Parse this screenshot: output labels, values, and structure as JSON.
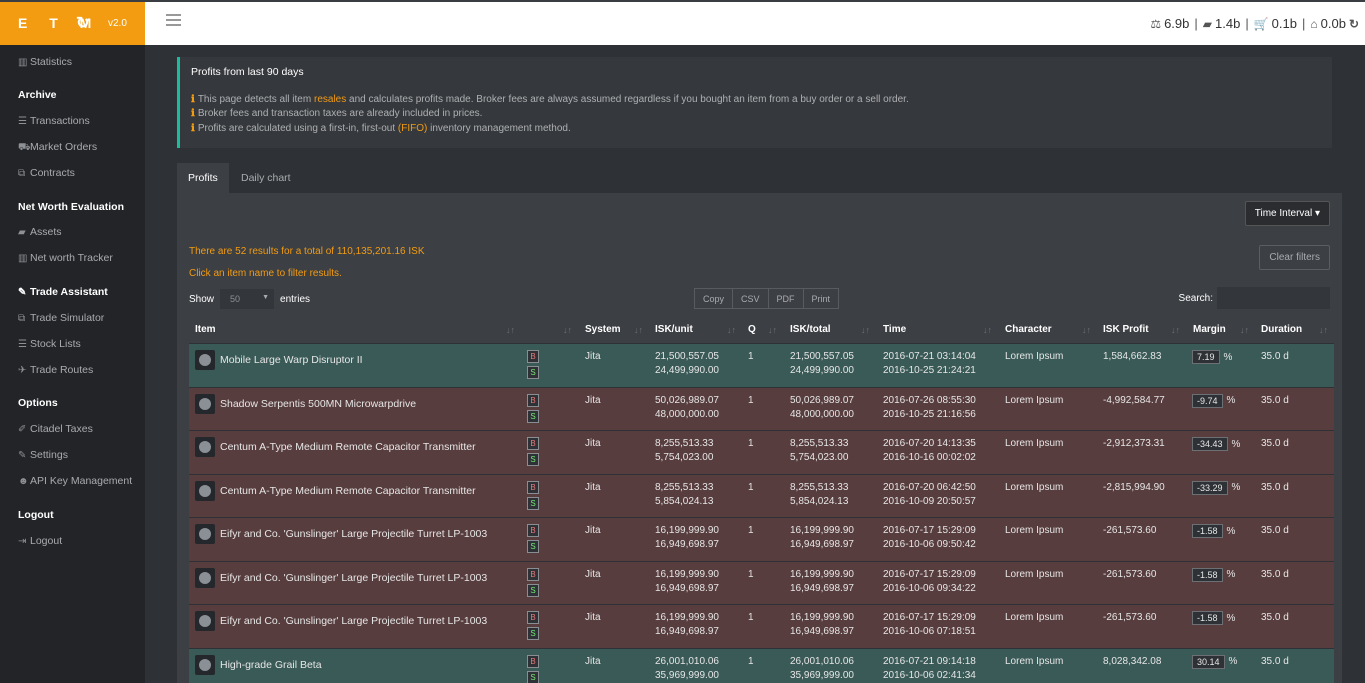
{
  "brand": {
    "logo": "E T M",
    "version": "v2.0"
  },
  "wallet": [
    {
      "icon": "balance-scale-icon",
      "value": "6.9b"
    },
    {
      "icon": "briefcase-icon",
      "value": "1.4b"
    },
    {
      "icon": "cart-icon",
      "value": "0.1b"
    },
    {
      "icon": "bank-icon",
      "value": "0.0b"
    }
  ],
  "sidebar": {
    "statistics": "Statistics",
    "archive_head": "Archive",
    "transactions": "Transactions",
    "market_orders": "Market Orders",
    "contracts": "Contracts",
    "networth_head": "Net Worth Evaluation",
    "assets": "Assets",
    "networth_tracker": "Net worth Tracker",
    "trade_assistant": "Trade Assistant",
    "trade_simulator": "Trade Simulator",
    "stock_lists": "Stock Lists",
    "trade_routes": "Trade Routes",
    "options_head": "Options",
    "citadel_taxes": "Citadel Taxes",
    "settings": "Settings",
    "api_key": "API Key Management",
    "logout_head": "Logout",
    "logout": "Logout"
  },
  "callout": {
    "title": "Profits from last 90 days",
    "line1_pre": "This page detects all item ",
    "line1_hl": "resales",
    "line1_post": " and calculates profits made. Broker fees are always assumed regardless if you bought an item from a buy order or a sell order.",
    "line2": "Broker fees and transaction taxes are already included in prices.",
    "line3_pre": "Profits are calculated using a first-in, first-out ",
    "line3_hl": "(FIFO)",
    "line3_post": " inventory management method."
  },
  "tabs": {
    "profits": "Profits",
    "daily_chart": "Daily chart"
  },
  "panel": {
    "time_interval": "Time Interval",
    "results": "There are 52 results for a total of 110,135,201.16 ISK",
    "hint": "Click an item name to filter results.",
    "clear_filters": "Clear filters",
    "show": "Show",
    "entries_value": "50",
    "entries": "entries",
    "search": "Search:",
    "exports": {
      "copy": "Copy",
      "csv": "CSV",
      "pdf": "PDF",
      "print": "Print"
    }
  },
  "columns": {
    "item": "Item",
    "system": "System",
    "isk_unit": "ISK/unit",
    "q": "Q",
    "isk_total": "ISK/total",
    "time": "Time",
    "character": "Character",
    "isk_profit": "ISK Profit",
    "margin": "Margin",
    "duration": "Duration"
  },
  "rows": [
    {
      "status": "pos",
      "item": "Mobile Large Warp Disruptor II",
      "system": "Jita",
      "unit1": "21,500,557.05",
      "unit2": "24,499,990.00",
      "q": "1",
      "total1": "21,500,557.05",
      "total2": "24,499,990.00",
      "time1": "2016-07-21 03:14:04",
      "time2": "2016-10-25 21:24:21",
      "character": "Lorem Ipsum",
      "profit": "1,584,662.83",
      "margin": "7.19",
      "duration": "35.0 d"
    },
    {
      "status": "neg",
      "item": "Shadow Serpentis 500MN Microwarpdrive",
      "system": "Jita",
      "unit1": "50,026,989.07",
      "unit2": "48,000,000.00",
      "q": "1",
      "total1": "50,026,989.07",
      "total2": "48,000,000.00",
      "time1": "2016-07-26 08:55:30",
      "time2": "2016-10-25 21:16:56",
      "character": "Lorem Ipsum",
      "profit": "-4,992,584.77",
      "margin": "-9.74",
      "duration": "35.0 d"
    },
    {
      "status": "neg",
      "item": "Centum A-Type Medium Remote Capacitor Transmitter",
      "system": "Jita",
      "unit1": "8,255,513.33",
      "unit2": "5,754,023.00",
      "q": "1",
      "total1": "8,255,513.33",
      "total2": "5,754,023.00",
      "time1": "2016-07-20 14:13:35",
      "time2": "2016-10-16 00:02:02",
      "character": "Lorem Ipsum",
      "profit": "-2,912,373.31",
      "margin": "-34.43",
      "duration": "35.0 d"
    },
    {
      "status": "neg",
      "item": "Centum A-Type Medium Remote Capacitor Transmitter",
      "system": "Jita",
      "unit1": "8,255,513.33",
      "unit2": "5,854,024.13",
      "q": "1",
      "total1": "8,255,513.33",
      "total2": "5,854,024.13",
      "time1": "2016-07-20 06:42:50",
      "time2": "2016-10-09 20:50:57",
      "character": "Lorem Ipsum",
      "profit": "-2,815,994.90",
      "margin": "-33.29",
      "duration": "35.0 d"
    },
    {
      "status": "neg",
      "item": "Eifyr and Co. 'Gunslinger' Large Projectile Turret LP-1003",
      "system": "Jita",
      "unit1": "16,199,999.90",
      "unit2": "16,949,698.97",
      "q": "1",
      "total1": "16,199,999.90",
      "total2": "16,949,698.97",
      "time1": "2016-07-17 15:29:09",
      "time2": "2016-10-06 09:50:42",
      "character": "Lorem Ipsum",
      "profit": "-261,573.60",
      "margin": "-1.58",
      "duration": "35.0 d"
    },
    {
      "status": "neg",
      "item": "Eifyr and Co. 'Gunslinger' Large Projectile Turret LP-1003",
      "system": "Jita",
      "unit1": "16,199,999.90",
      "unit2": "16,949,698.97",
      "q": "1",
      "total1": "16,199,999.90",
      "total2": "16,949,698.97",
      "time1": "2016-07-17 15:29:09",
      "time2": "2016-10-06 09:34:22",
      "character": "Lorem Ipsum",
      "profit": "-261,573.60",
      "margin": "-1.58",
      "duration": "35.0 d"
    },
    {
      "status": "neg",
      "item": "Eifyr and Co. 'Gunslinger' Large Projectile Turret LP-1003",
      "system": "Jita",
      "unit1": "16,199,999.90",
      "unit2": "16,949,698.97",
      "q": "1",
      "total1": "16,199,999.90",
      "total2": "16,949,698.97",
      "time1": "2016-07-17 15:29:09",
      "time2": "2016-10-06 07:18:51",
      "character": "Lorem Ipsum",
      "profit": "-261,573.60",
      "margin": "-1.58",
      "duration": "35.0 d"
    },
    {
      "status": "pos",
      "item": "High-grade Grail Beta",
      "system": "Jita",
      "unit1": "26,001,010.06",
      "unit2": "35,969,999.00",
      "q": "1",
      "total1": "26,001,010.06",
      "total2": "35,969,999.00",
      "time1": "2016-07-21 09:14:18",
      "time2": "2016-10-06 02:41:34",
      "character": "Lorem Ipsum",
      "profit": "8,028,342.08",
      "margin": "30.14",
      "duration": "35.0 d"
    }
  ],
  "colors": {
    "accent": "#f39c12",
    "positive_row": "#3a5a58",
    "negative_row": "#583d3e",
    "callout_border": "#1abc9c"
  }
}
